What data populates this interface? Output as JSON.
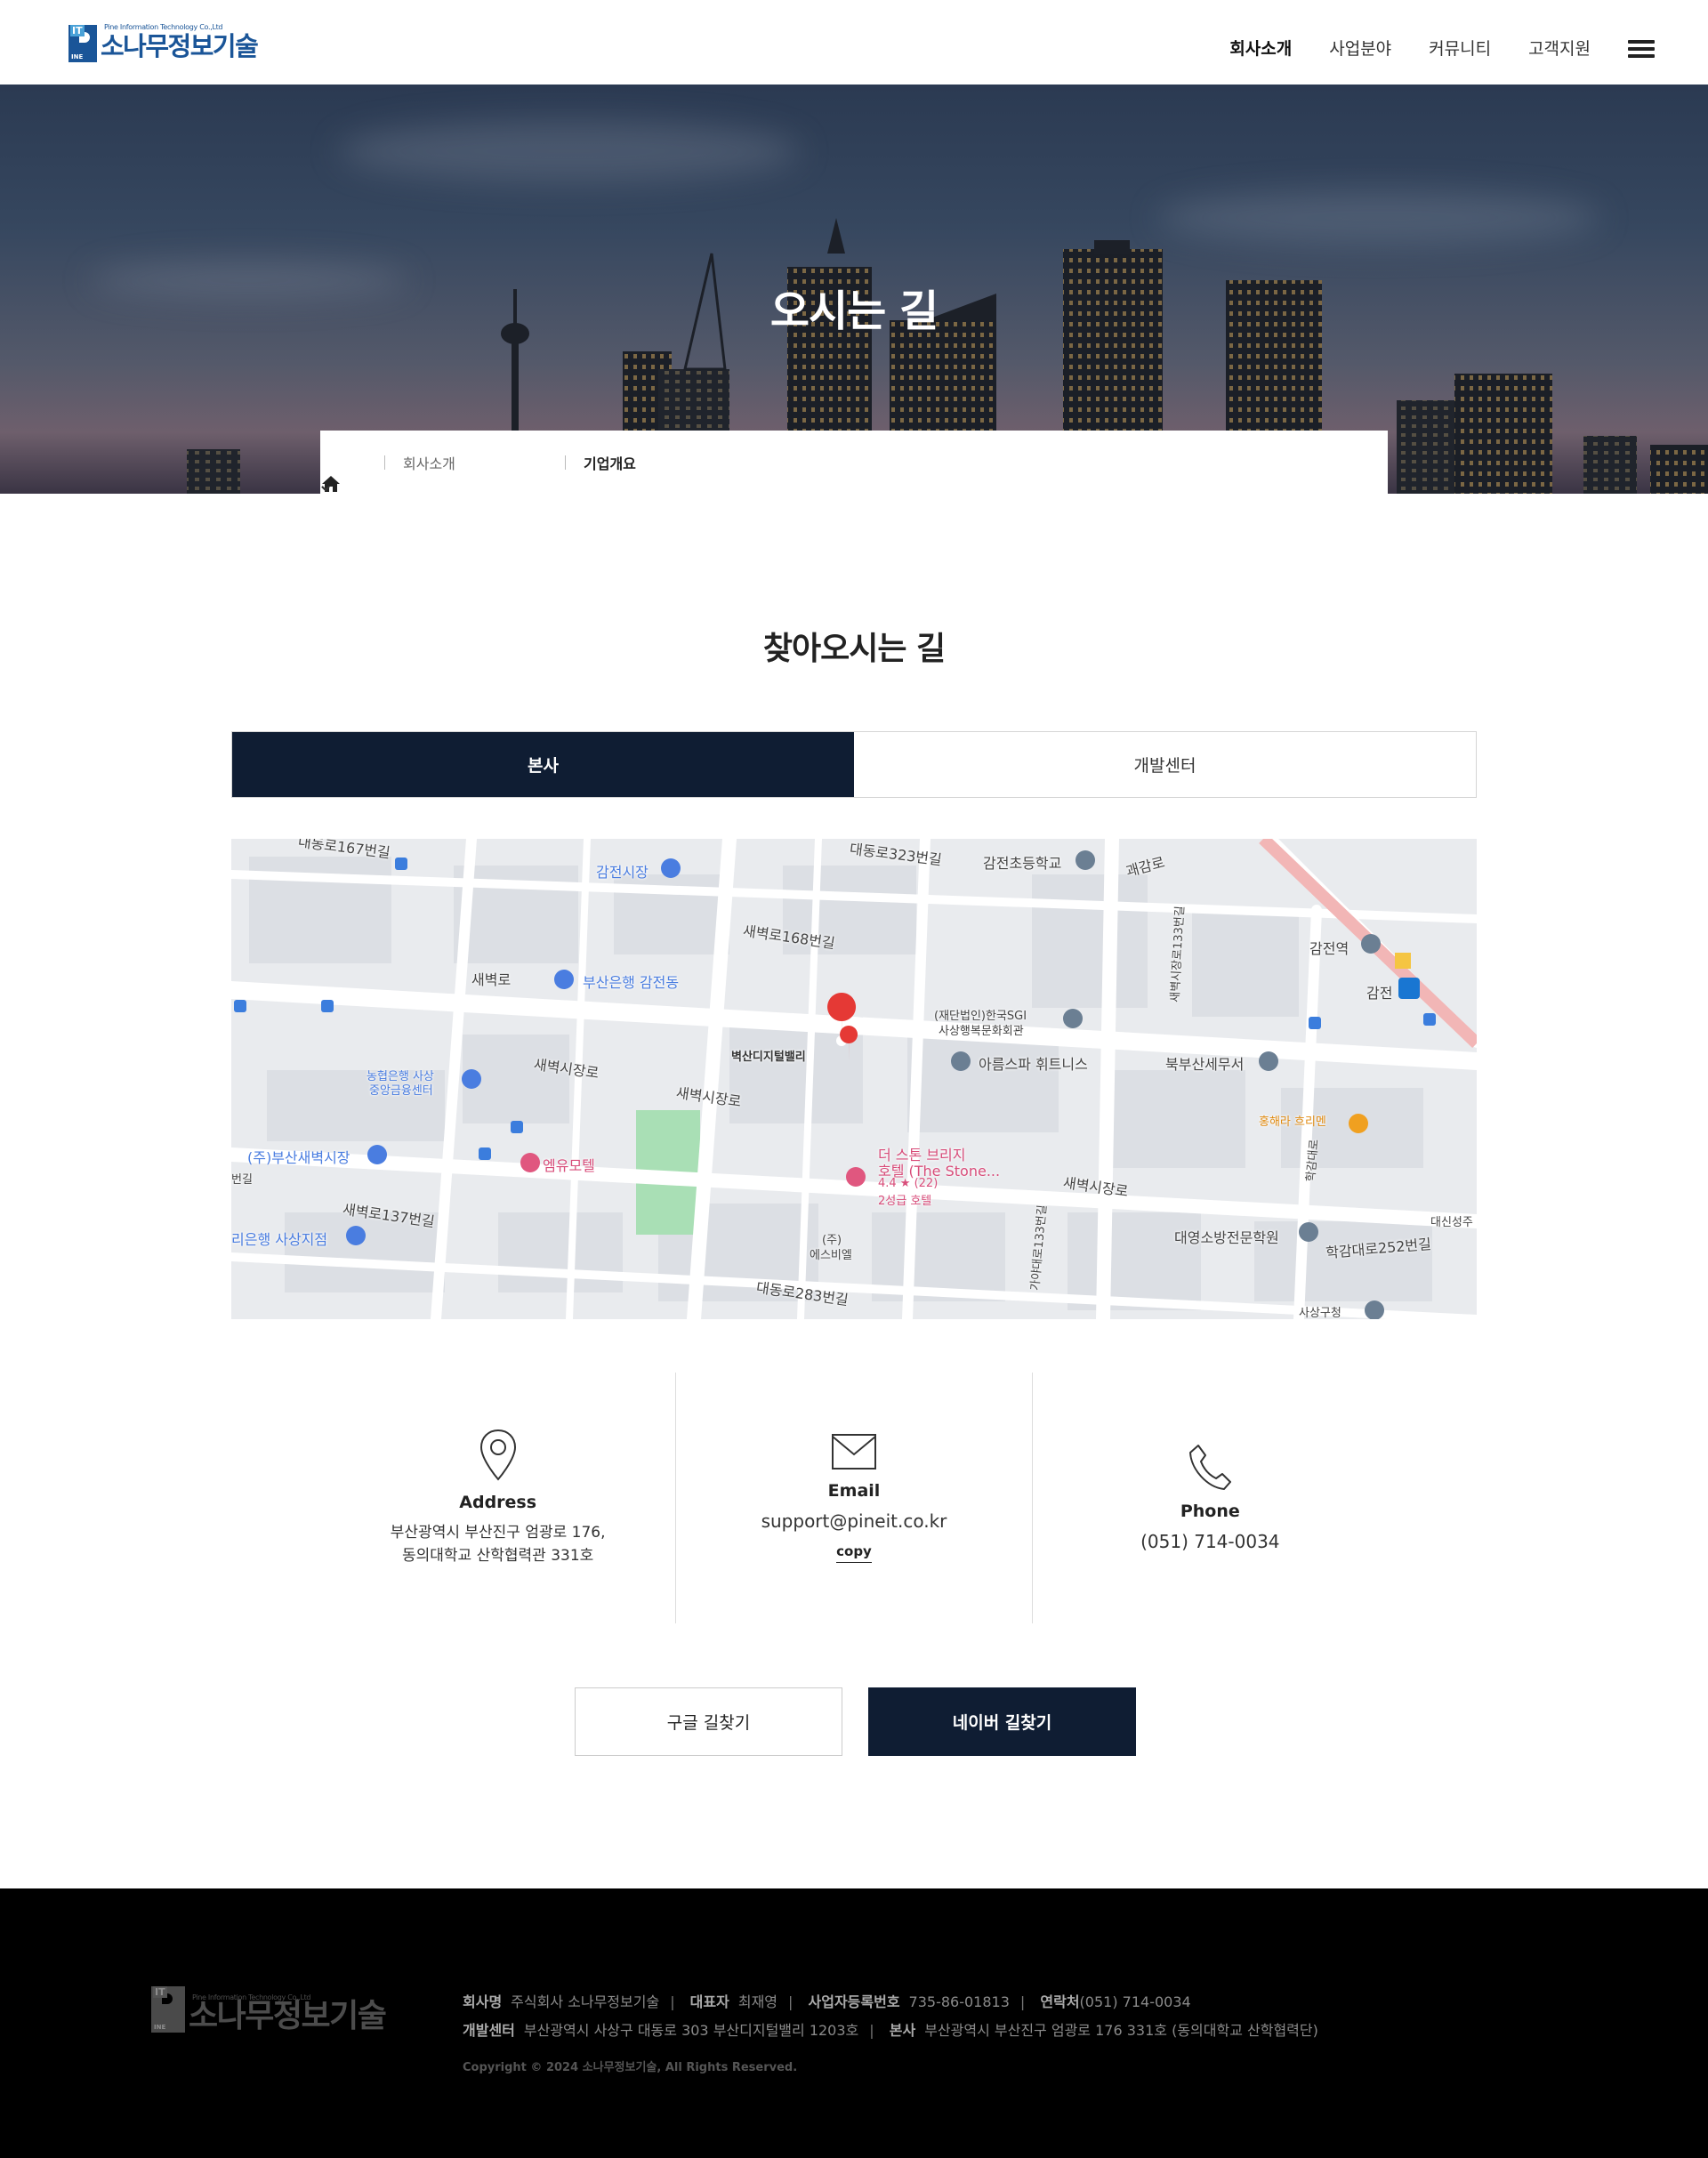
{
  "header": {
    "logo": {
      "en": "Pine Information Technology Co.,Ltd",
      "ko": "소나무정보기술",
      "mark_top": "IT",
      "mark_bottom": "INE"
    },
    "nav": [
      "회사소개",
      "사업분야",
      "커뮤니티",
      "고객지원"
    ]
  },
  "hero": {
    "title": "오시는 길",
    "breadcrumb": {
      "level1": "회사소개",
      "level2": "기업개요"
    }
  },
  "main": {
    "title": "찾아오시는 길",
    "tabs": [
      "본사",
      "개발센터"
    ],
    "map": {
      "labels": [
        "대동로167번길",
        "감전시장",
        "대동로323번길",
        "감전초등학교",
        "괘감로",
        "새벽로168번길",
        "새벽로",
        "부산은행 감전동",
        "(재단법인)한국SGI",
        "사상행복문화회관",
        "감전역",
        "감전",
        "새벽시장로133번길",
        "벽산디지털밸리",
        "새벽시장로",
        "아름스파 휘트니스",
        "북부산세무서",
        "농협은행 사상",
        "중앙금융센터",
        "새벽시장로",
        "홍해라 흐리멘",
        "(주)부산새벽시장",
        "엠유모텔",
        "더 스톤 브리지",
        "호텔 (The Stone...",
        "4.4 ★ (22)",
        "2성급 호텔",
        "새벽로137번길",
        "리은행 사상지점",
        "(주)",
        "에스비엘",
        "대영소방전문학원",
        "학감대로252번길",
        "대동로283번길",
        "가야대로133번길",
        "사상구청",
        "대신성주",
        "새벽시장로",
        "번길",
        "학감대로"
      ]
    },
    "info": {
      "address": {
        "title": "Address",
        "line1": "부산광역시 부산진구 엄광로 176,",
        "line2": "동의대학교 산학협력관 331호"
      },
      "email": {
        "title": "Email",
        "value": "support@pineit.co.kr",
        "copy": "copy"
      },
      "phone": {
        "title": "Phone",
        "value": "(051) 714-0034"
      }
    },
    "buttons": {
      "google": "구글 길찾기",
      "naver": "네이버 길찾기"
    }
  },
  "footer": {
    "company_label": "회사명",
    "company": "주식회사 소나무정보기술",
    "ceo_label": "대표자",
    "ceo": "최재영",
    "bizno_label": "사업자등록번호",
    "bizno": "735-86-01813",
    "contact_label": "연락처",
    "contact": "(051) 714-0034",
    "devcenter_label": "개발센터",
    "devcenter": "부산광역시 사상구 대동로 303 부산디지털밸리 1203호",
    "hq_label": "본사",
    "hq": "부산광역시 부산진구 엄광로 176 331호 (동의대학교 산학협력단)",
    "copyright": "Copyright © 2024 소나무정보기술, All Rights Reserved."
  },
  "colors": {
    "brand": "#1a5598",
    "navy": "#0f1d33",
    "footer": "#000000"
  }
}
